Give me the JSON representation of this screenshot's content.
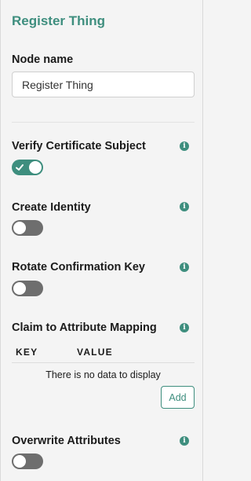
{
  "panel": {
    "title": "Register Thing"
  },
  "node_name": {
    "label": "Node name",
    "value": "Register Thing"
  },
  "verify_certificate_subject": {
    "label": "Verify Certificate Subject",
    "enabled": true
  },
  "create_identity": {
    "label": "Create Identity",
    "enabled": false
  },
  "rotate_confirmation_key": {
    "label": "Rotate Confirmation Key",
    "enabled": false
  },
  "claim_mapping": {
    "label": "Claim to Attribute Mapping",
    "columns": [
      "KEY",
      "VALUE"
    ],
    "empty_text": "There is no data to display",
    "add_label": "Add"
  },
  "overwrite_attributes": {
    "label": "Overwrite Attributes",
    "enabled": false
  },
  "icons": {
    "info": "info-icon",
    "check": "check-icon"
  },
  "colors": {
    "accent": "#3e8e7e",
    "toggle_off": "#6e6e6e",
    "background": "#f4f4f4"
  }
}
